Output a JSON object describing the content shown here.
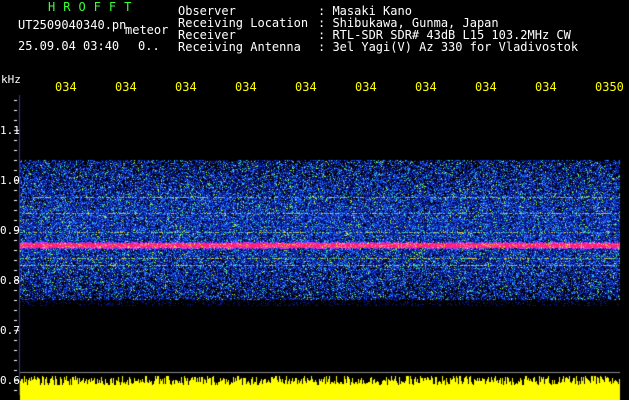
{
  "header": {
    "app_title": "HROFFT",
    "filename": "UT2509040340.pn",
    "mode": "meteor",
    "datetime": "25.09.04 03:40",
    "extra": "0.."
  },
  "metadata": [
    {
      "label": "Observer",
      "value": ": Masaki Kano"
    },
    {
      "label": "Receiving Location",
      "value": ": Shibukawa, Gunma, Japan"
    },
    {
      "label": "Receiver",
      "value": ": RTL-SDR SDR# 43dB L15 103.2MHz CW"
    },
    {
      "label": "Receiving Antenna",
      "value": ": 3el Yagi(V) Az 330 for Vladivostok"
    }
  ],
  "axes": {
    "unit": "kHz",
    "time_ticks": [
      "034",
      "034",
      "034",
      "034",
      "034",
      "034",
      "034",
      "034",
      "034",
      "0350"
    ],
    "freq_ticks": [
      "1.1",
      "1.0",
      "0.9",
      "0.8",
      "0.7",
      "0.6"
    ]
  },
  "colors": {
    "background": "#000000",
    "title": "#3cff3c",
    "ticks": "#ffff00",
    "noise_low": "#0a1a8c",
    "noise_mid": "#1e5cff",
    "noise_high": "#3cc8b4",
    "carrier": "#ff1e78",
    "signal_bar": "#ffff00"
  }
}
